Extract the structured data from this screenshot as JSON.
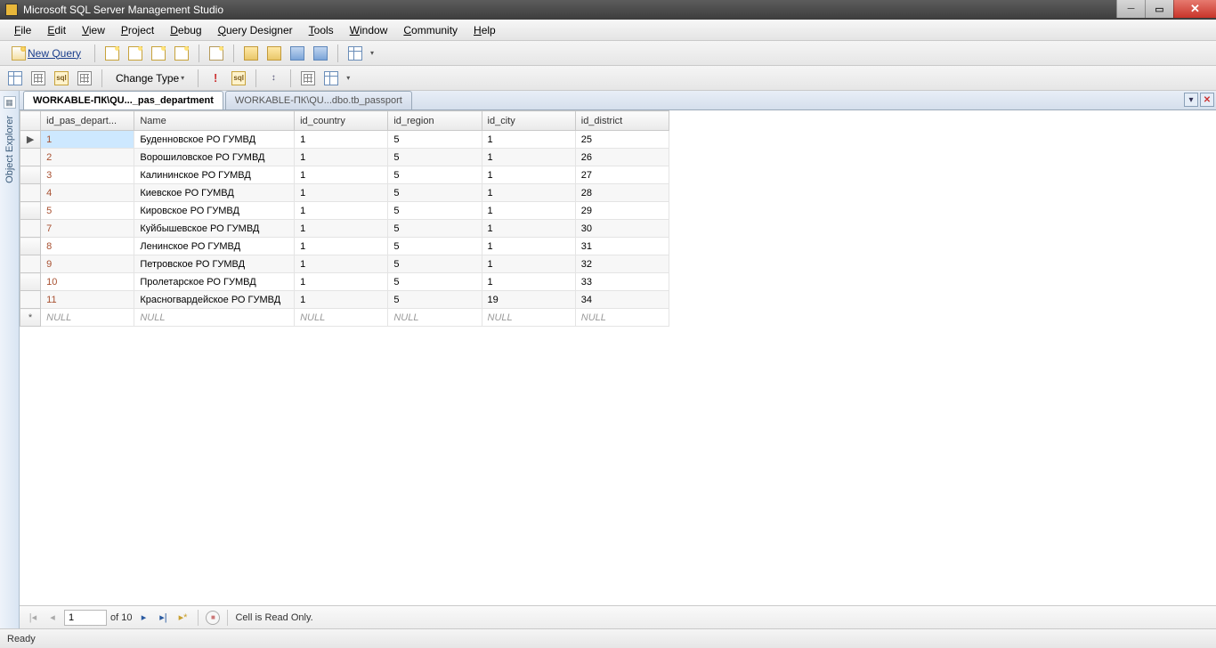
{
  "title": "Microsoft SQL Server Management Studio",
  "menus": [
    "File",
    "Edit",
    "View",
    "Project",
    "Debug",
    "Query Designer",
    "Tools",
    "Window",
    "Community",
    "Help"
  ],
  "toolbar1": {
    "new_query": "New Query"
  },
  "toolbar2": {
    "change_type": "Change Type"
  },
  "object_explorer_label": "Object Explorer",
  "tabs": [
    {
      "label": "WORKABLE-ПК\\QU..._pas_department",
      "active": true
    },
    {
      "label": "WORKABLE-ПК\\QU...dbo.tb_passport",
      "active": false
    }
  ],
  "columns": [
    "id_pas_depart...",
    "Name",
    "id_country",
    "id_region",
    "id_city",
    "id_district"
  ],
  "rows": [
    {
      "id": "1",
      "name": "Буденновское РО ГУМВД",
      "country": "1",
      "region": "5",
      "city": "1",
      "district": "25"
    },
    {
      "id": "2",
      "name": "Ворошиловское РО ГУМВД",
      "country": "1",
      "region": "5",
      "city": "1",
      "district": "26"
    },
    {
      "id": "3",
      "name": "Калининское РО ГУМВД",
      "country": "1",
      "region": "5",
      "city": "1",
      "district": "27"
    },
    {
      "id": "4",
      "name": "Киевское РО ГУМВД",
      "country": "1",
      "region": "5",
      "city": "1",
      "district": "28"
    },
    {
      "id": "5",
      "name": "Кировское РО ГУМВД",
      "country": "1",
      "region": "5",
      "city": "1",
      "district": "29"
    },
    {
      "id": "7",
      "name": "Куйбышевское РО ГУМВД",
      "country": "1",
      "region": "5",
      "city": "1",
      "district": "30"
    },
    {
      "id": "8",
      "name": "Ленинское РО ГУМВД",
      "country": "1",
      "region": "5",
      "city": "1",
      "district": "31"
    },
    {
      "id": "9",
      "name": "Петровское РО ГУМВД",
      "country": "1",
      "region": "5",
      "city": "1",
      "district": "32"
    },
    {
      "id": "10",
      "name": "Пролетарское РО ГУМВД",
      "country": "1",
      "region": "5",
      "city": "1",
      "district": "33"
    },
    {
      "id": "11",
      "name": "Красногвардейское РО ГУМВД",
      "country": "1",
      "region": "5",
      "city": "19",
      "district": "34"
    }
  ],
  "null_label": "NULL",
  "nav": {
    "current": "1",
    "of_label": "of 10",
    "readonly_msg": "Cell is Read Only."
  },
  "status": "Ready"
}
